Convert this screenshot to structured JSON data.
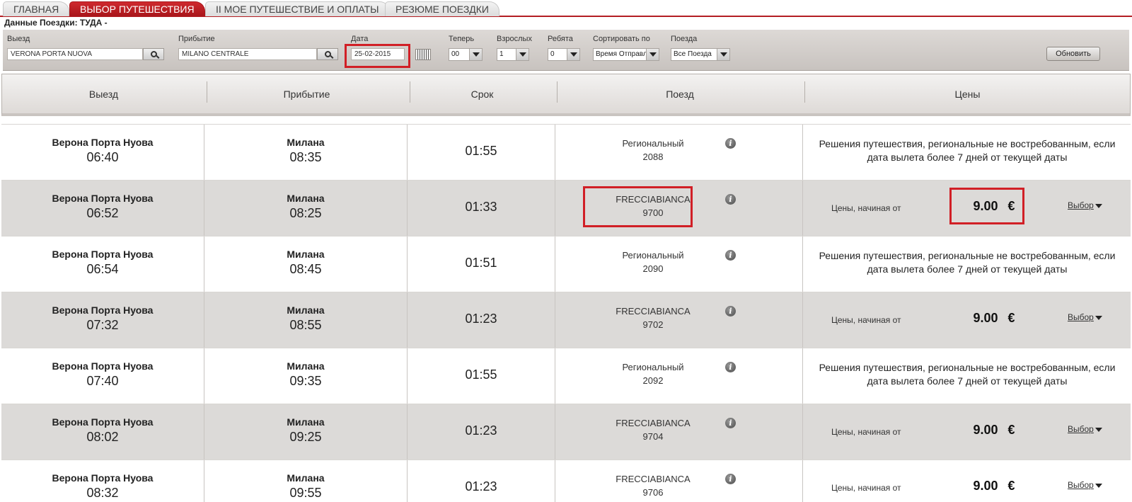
{
  "tabs": [
    {
      "label": "Главная",
      "active": false
    },
    {
      "label": "Выбор путешествия",
      "active": true
    },
    {
      "label": "II Мое путешествие и оплаты",
      "active": false
    },
    {
      "label": "Резюме поездки",
      "active": false
    }
  ],
  "subtitle": "Данные Поездки: ТУДА -",
  "search": {
    "departure_label": "Выезд",
    "departure_value": "VERONA PORTA NUOVA",
    "arrival_label": "Прибытие",
    "arrival_value": "MILANO CENTRALE",
    "date_label": "Дата",
    "date_value": "25-02-2015",
    "now_label": "Теперь",
    "now_value": "00",
    "adults_label": "Взрослых",
    "adults_value": "1",
    "children_label": "Ребята",
    "children_value": "0",
    "sort_label": "Сортировать по",
    "sort_value": "Время Отправл",
    "trains_label": "Поезда",
    "trains_value": "Все Поезда",
    "refresh_label": "Обновить"
  },
  "columns": {
    "departure": "Выезд",
    "arrival": "Прибытие",
    "duration": "Срок",
    "train": "Поезд",
    "prices": "Цены"
  },
  "rows": [
    {
      "dep_station": "Верона Порта Нуова",
      "dep_time": "06:40",
      "arr_station": "Милана",
      "arr_time": "08:35",
      "duration": "01:55",
      "train_name": "Региональный",
      "train_number": "2088",
      "message": "Решения путешествия, региональные не востребованным, если дата вылета более 7 дней от текущей даты"
    },
    {
      "dep_station": "Верона Порта Нуова",
      "dep_time": "06:52",
      "arr_station": "Милана",
      "arr_time": "08:25",
      "duration": "01:33",
      "train_name": "FRECCIABIANCA",
      "train_number": "9700",
      "price_from": "Цены, начиная от",
      "price": "9.00",
      "currency": "€",
      "select": "Выбор"
    },
    {
      "dep_station": "Верона Порта Нуова",
      "dep_time": "06:54",
      "arr_station": "Милана",
      "arr_time": "08:45",
      "duration": "01:51",
      "train_name": "Региональный",
      "train_number": "2090",
      "message": "Решения путешествия, региональные не востребованным, если дата вылета более 7 дней от текущей даты"
    },
    {
      "dep_station": "Верона Порта Нуова",
      "dep_time": "07:32",
      "arr_station": "Милана",
      "arr_time": "08:55",
      "duration": "01:23",
      "train_name": "FRECCIABIANCA",
      "train_number": "9702",
      "price_from": "Цены, начиная от",
      "price": "9.00",
      "currency": "€",
      "select": "Выбор"
    },
    {
      "dep_station": "Верона Порта Нуова",
      "dep_time": "07:40",
      "arr_station": "Милана",
      "arr_time": "09:35",
      "duration": "01:55",
      "train_name": "Региональный",
      "train_number": "2092",
      "message": "Решения путешествия, региональные не востребованным, если дата вылета более 7 дней от текущей даты"
    },
    {
      "dep_station": "Верона Порта Нуова",
      "dep_time": "08:02",
      "arr_station": "Милана",
      "arr_time": "09:25",
      "duration": "01:23",
      "train_name": "FRECCIABIANCA",
      "train_number": "9704",
      "price_from": "Цены, начиная от",
      "price": "9.00",
      "currency": "€",
      "select": "Выбор"
    },
    {
      "dep_station": "Верона Порта Нуова",
      "dep_time": "08:32",
      "arr_station": "Милана",
      "arr_time": "09:55",
      "duration": "01:23",
      "train_name": "FRECCIABIANCA",
      "train_number": "9706",
      "price_from": "Цены, начиная от",
      "price": "9.00",
      "currency": "€",
      "select": "Выбор"
    }
  ],
  "icons": {
    "search": "magnifier-icon",
    "calendar": "calendar-icon",
    "info": "info-icon",
    "dropdown": "chevron-down-icon"
  },
  "colors": {
    "brand_red": "#b41e23",
    "highlight_red": "#d11f26",
    "row_alt": "#dcdad8"
  }
}
